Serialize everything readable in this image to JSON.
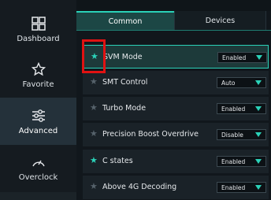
{
  "sidebar": {
    "items": [
      {
        "label": "Dashboard",
        "icon": "dashboard-icon",
        "active": false
      },
      {
        "label": "Favorite",
        "icon": "star-outline-icon",
        "active": false
      },
      {
        "label": "Advanced",
        "icon": "sliders-icon",
        "active": true
      },
      {
        "label": "Overclock",
        "icon": "gauge-icon",
        "active": false
      }
    ]
  },
  "tabs": [
    {
      "label": "Common",
      "active": true
    },
    {
      "label": "Devices",
      "active": false
    }
  ],
  "settings": [
    {
      "name": "SVM Mode",
      "value": "Enabled",
      "favorite": true,
      "selected": true
    },
    {
      "name": "SMT Control",
      "value": "Auto",
      "favorite": false,
      "selected": false
    },
    {
      "name": "Turbo Mode",
      "value": "Enabled",
      "favorite": false,
      "selected": false
    },
    {
      "name": "Precision Boost Overdrive",
      "value": "Disable",
      "favorite": false,
      "selected": false
    },
    {
      "name": "C states",
      "value": "Enabled",
      "favorite": true,
      "selected": false
    },
    {
      "name": "Above 4G Decoding",
      "value": "Enabled",
      "favorite": false,
      "selected": false
    }
  ],
  "colors": {
    "accent": "#2bd2b8",
    "highlight": "#e11212",
    "sidebar_active": "#24313a"
  }
}
